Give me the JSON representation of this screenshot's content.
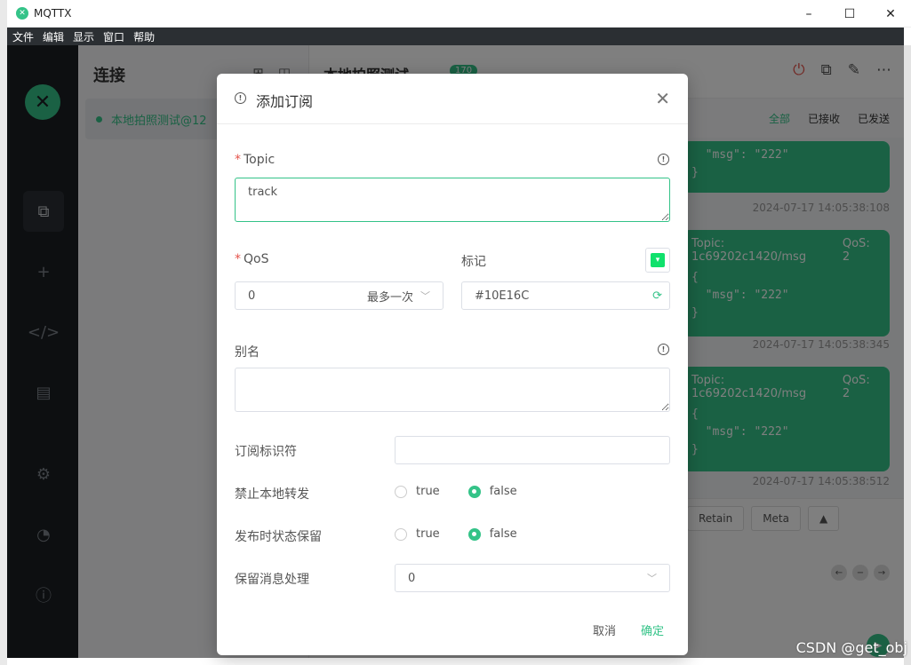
{
  "window": {
    "title": "MQTTX",
    "min": "–",
    "max": "☐",
    "close": "✕"
  },
  "menu": [
    "文件",
    "编辑",
    "显示",
    "窗口",
    "帮助"
  ],
  "connections": {
    "heading": "连接",
    "item_label": "本地拍照测试@12"
  },
  "main": {
    "conn_title": "本地拍照测试",
    "badge": "170",
    "filter_tabs": [
      "全部",
      "已接收",
      "已发送"
    ],
    "messages": [
      {
        "topic": "",
        "qos": "",
        "lines": [
          "  \"msg\": \"222\"",
          "}"
        ],
        "time": "2024-07-17 14:05:38:108"
      },
      {
        "topic": "Topic: 1c69202c1420/msg",
        "qos": "QoS: 2",
        "lines": [
          "{",
          "  \"msg\": \"222\"",
          "}"
        ],
        "time": "2024-07-17 14:05:38:345"
      },
      {
        "topic": "Topic: 1c69202c1420/msg",
        "qos": "QoS: 2",
        "lines": [
          "{",
          "  \"msg\": \"222\"",
          "}"
        ],
        "time": "2024-07-17 14:05:38:512"
      }
    ],
    "compose": {
      "retain": "Retain",
      "meta": "Meta"
    }
  },
  "dialog": {
    "title": "添加订阅",
    "topic_label": "Topic",
    "topic_value": "track",
    "qos_label": "QoS",
    "qos_value": "0",
    "qos_hint": "最多一次",
    "mark_label": "标记",
    "color_value": "#10E16C",
    "alias_label": "别名",
    "alias_value": "",
    "sub_id_label": "订阅标识符",
    "sub_id_value": "",
    "no_local_label": "禁止本地转发",
    "rap_label": "发布时状态保留",
    "retain_handling_label": "保留消息处理",
    "retain_handling_value": "0",
    "opt_true": "true",
    "opt_false": "false",
    "cancel": "取消",
    "confirm": "确定"
  },
  "colors": {
    "accent": "#34c388",
    "mark": "#10e16c"
  },
  "watermark": "CSDN @get_obj"
}
